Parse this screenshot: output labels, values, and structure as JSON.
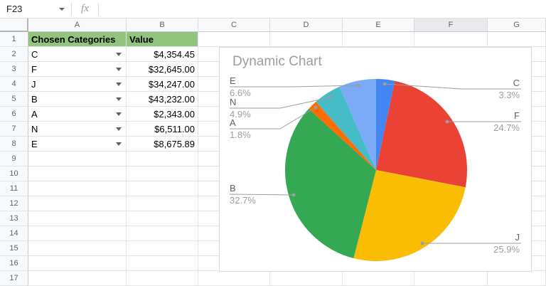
{
  "toolbar": {
    "name_box": "F23",
    "fx_label": "fx"
  },
  "grid": {
    "column_headers": [
      "A",
      "B",
      "C",
      "D",
      "E",
      "F",
      "G"
    ],
    "selected_column": "F",
    "row_count": 17,
    "table": {
      "header_bg": "#93c47d",
      "headers": [
        "Chosen Categories",
        "Value"
      ],
      "rows": [
        {
          "category": "C",
          "value": "$4,354.45"
        },
        {
          "category": "F",
          "value": "$32,645.00"
        },
        {
          "category": "J",
          "value": "$34,247.00"
        },
        {
          "category": "B",
          "value": "$43,232.00"
        },
        {
          "category": "A",
          "value": "$2,343.00"
        },
        {
          "category": "N",
          "value": "$6,511.00"
        },
        {
          "category": "E",
          "value": "$8,675.89"
        }
      ]
    }
  },
  "chart_data": {
    "type": "pie",
    "title": "Dynamic Chart",
    "categories": [
      "C",
      "F",
      "J",
      "B",
      "A",
      "N",
      "E"
    ],
    "values": [
      4354.45,
      32645.0,
      34247.0,
      43232.0,
      2343.0,
      6511.0,
      8675.89
    ],
    "percent_labels": [
      "3.3%",
      "24.7%",
      "25.9%",
      "32.7%",
      "1.8%",
      "4.9%",
      "6.6%"
    ],
    "colors": [
      "#4285f4",
      "#ea4335",
      "#fbbc04",
      "#34a853",
      "#ff6d01",
      "#46bdc6",
      "#7baaf7"
    ],
    "start_angle_deg": 0,
    "direction": "clockwise",
    "legend_position": "labeled-callouts",
    "label_color": "#616161",
    "percent_color": "#9e9e9e",
    "leader_line_color": "#9e9e9e"
  }
}
